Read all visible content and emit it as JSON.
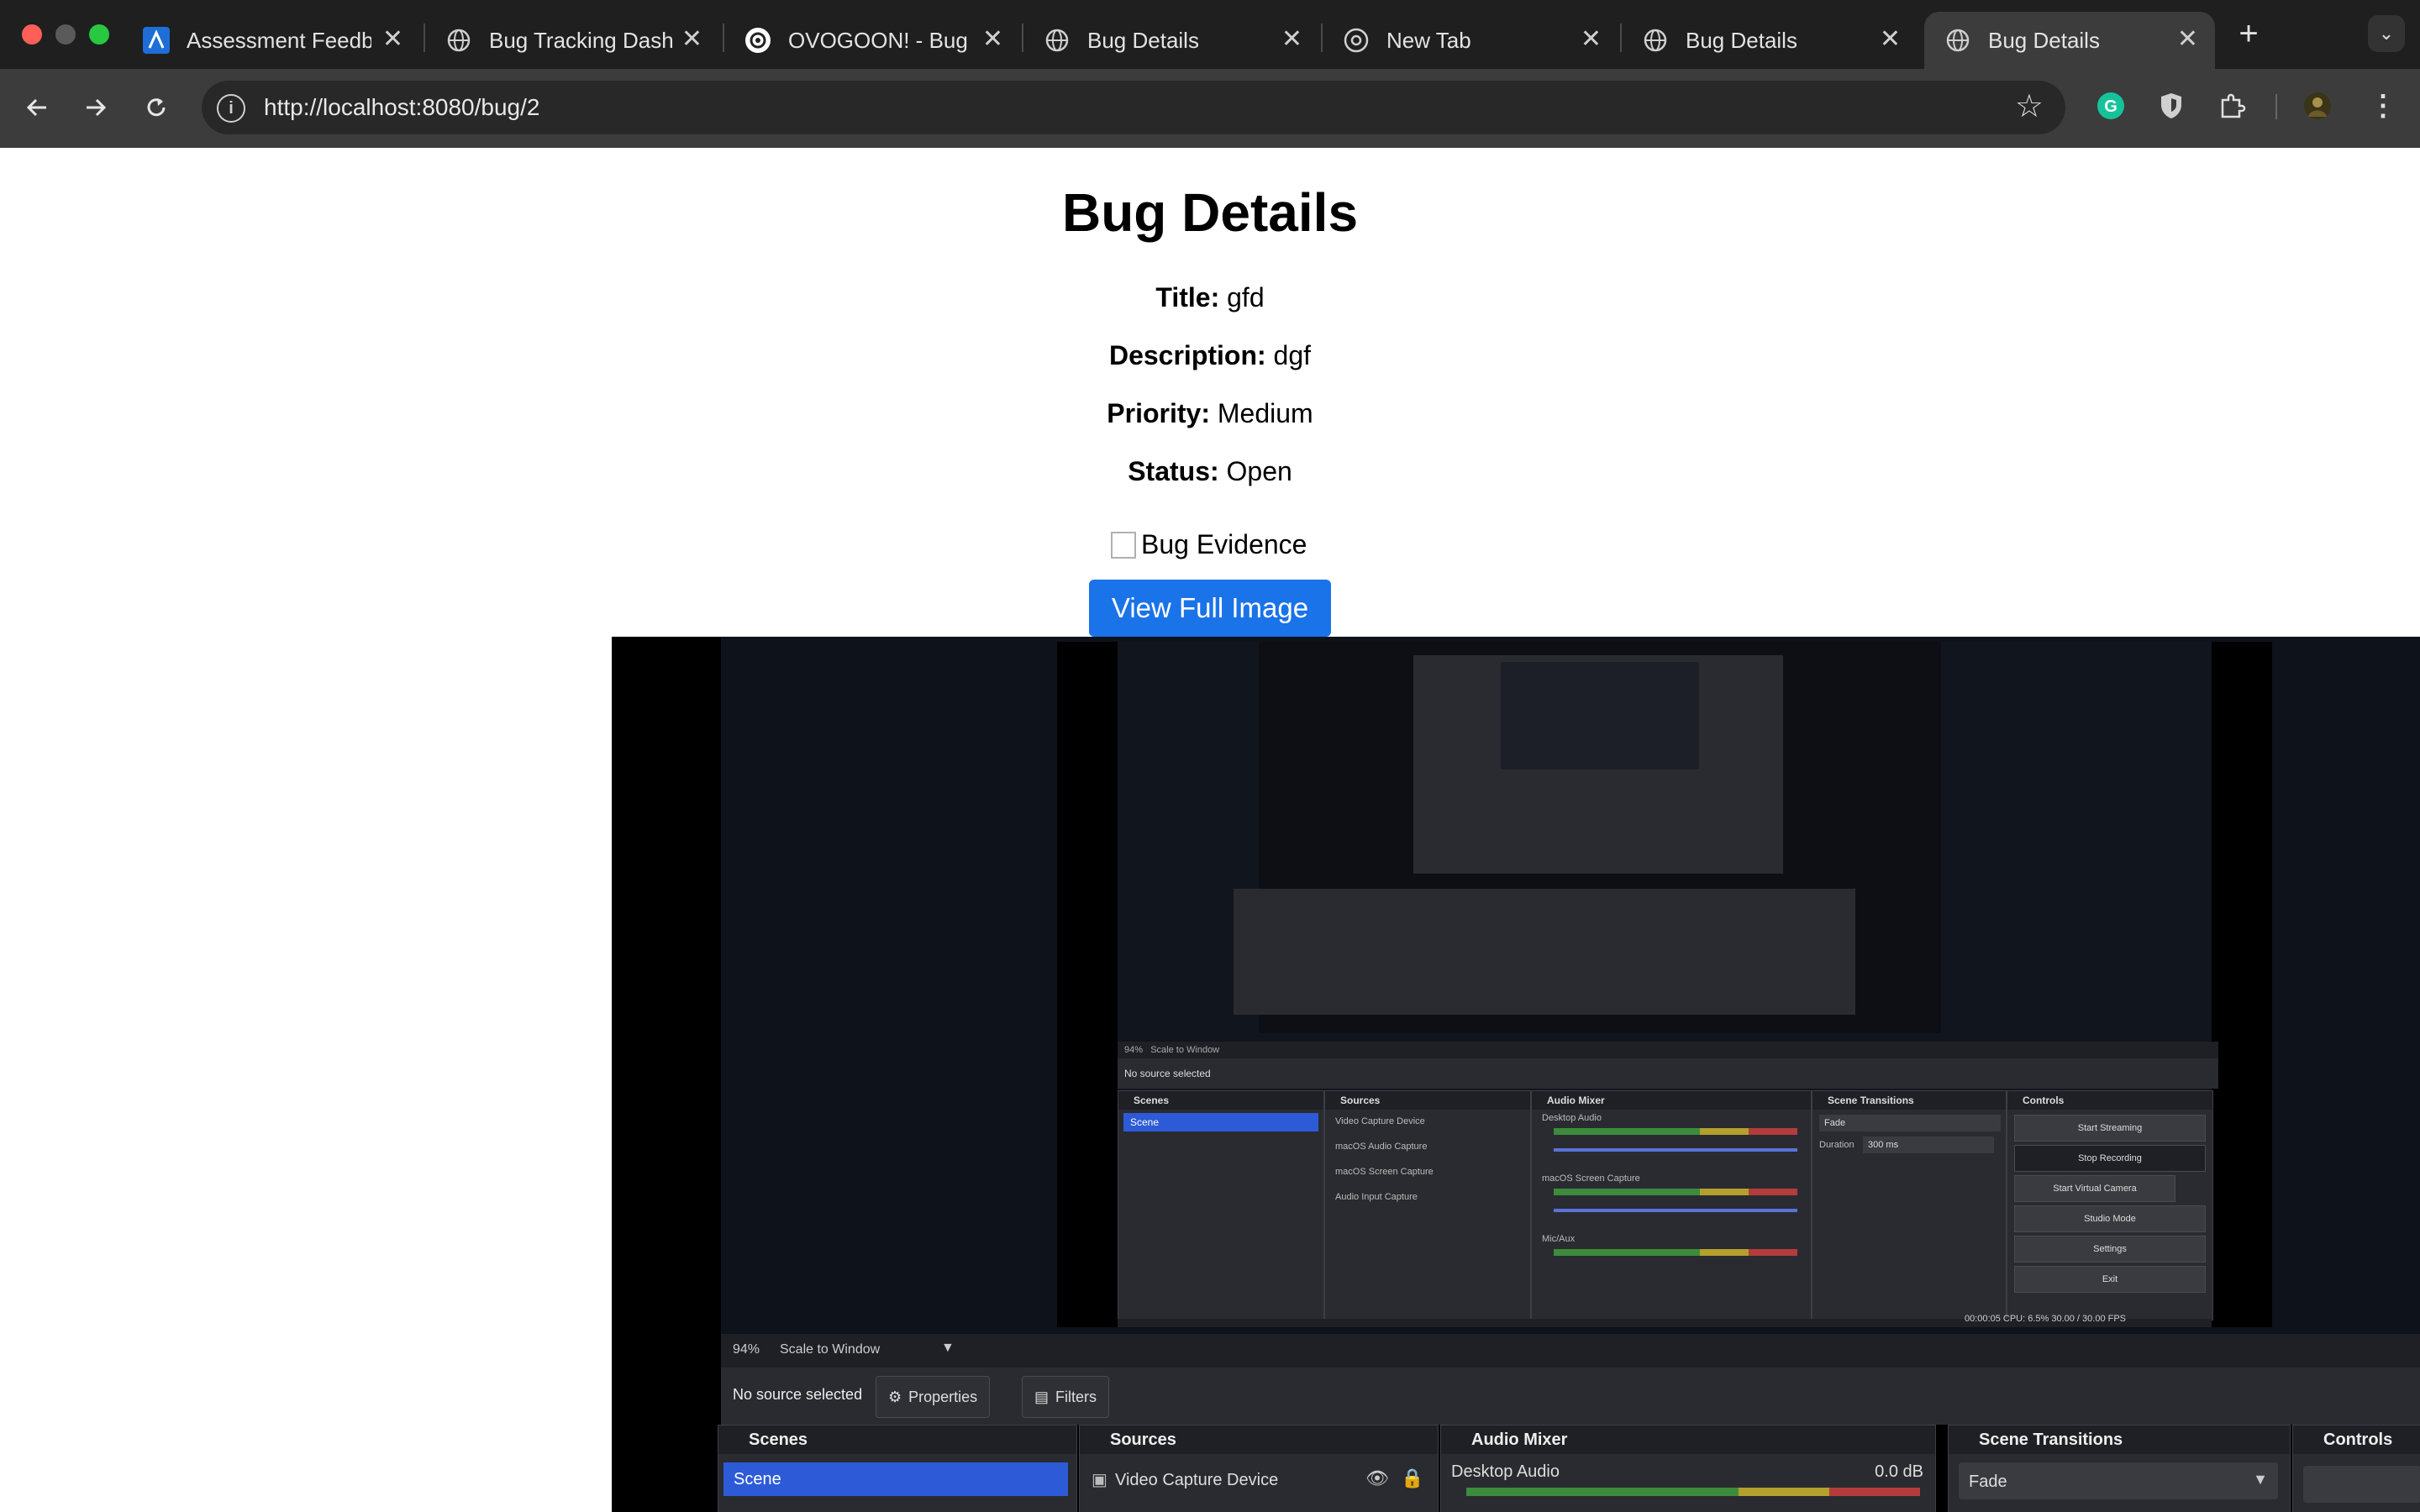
{
  "browser": {
    "tabs": [
      {
        "title": "Assessment Feedb",
        "icon": "app-icon"
      },
      {
        "title": "Bug Tracking Dash",
        "icon": "globe-icon"
      },
      {
        "title": "OVOGOON! - Bug",
        "icon": "openai-icon"
      },
      {
        "title": "Bug Details",
        "icon": "globe-icon"
      },
      {
        "title": "New Tab",
        "icon": "chrome-icon"
      },
      {
        "title": "Bug Details",
        "icon": "globe-icon"
      },
      {
        "title": "Bug Details",
        "icon": "globe-icon",
        "active": true
      }
    ],
    "url": "http://localhost:8080/bug/2"
  },
  "page": {
    "heading": "Bug Details",
    "fields": [
      {
        "label": "Title:",
        "value": "gfd"
      },
      {
        "label": "Description:",
        "value": "dgf"
      },
      {
        "label": "Priority:",
        "value": "Medium"
      },
      {
        "label": "Status:",
        "value": "Open"
      }
    ],
    "image_alt": "Bug Evidence",
    "view_button": "View Full Image"
  },
  "obs": {
    "zoom": "94%",
    "scale": "Scale to Window",
    "no_source": "No source selected",
    "properties": "Properties",
    "filters": "Filters",
    "docks": [
      "Scenes",
      "Sources",
      "Audio Mixer",
      "Scene Transitions",
      "Controls"
    ],
    "scene": "Scene",
    "source_first": "Video Capture Device",
    "audio_first": "Desktop Audio",
    "audio_db": "0.0 dB",
    "transition": "Fade",
    "inner": {
      "sources": [
        "Video Capture Device",
        "macOS Audio Capture",
        "macOS Screen Capture",
        "Audio Input Capture"
      ],
      "audio": [
        "Desktop Audio",
        "macOS Screen Capture",
        "Mic/Aux"
      ],
      "controls": [
        "Start Streaming",
        "Stop Recording",
        "Start Virtual Camera",
        "Studio Mode",
        "Settings",
        "Exit"
      ],
      "duration_label": "Duration",
      "duration": "300 ms",
      "status": "00:00:05   CPU: 6.5%   30.00 / 30.00 FPS"
    }
  }
}
